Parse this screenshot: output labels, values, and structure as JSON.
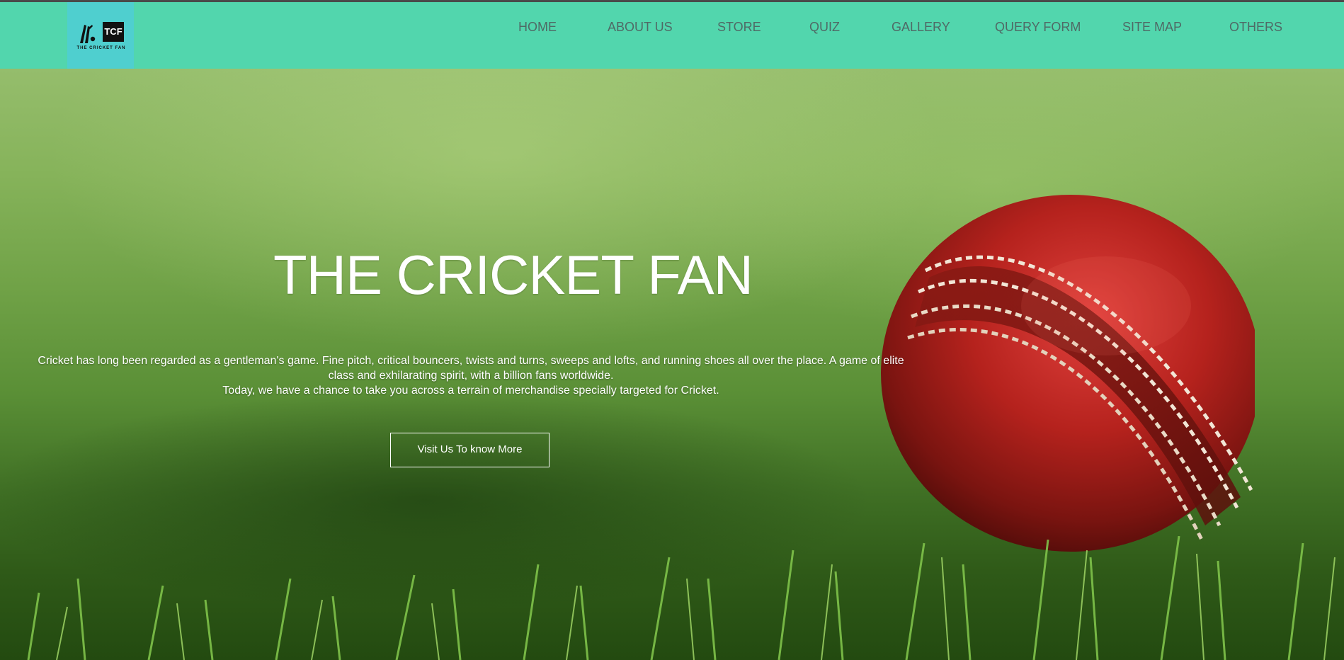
{
  "brand": {
    "logo_badge": "TCF",
    "logo_subtitle": "THE CRICKET FAN"
  },
  "nav": {
    "items": [
      {
        "label": "HOME"
      },
      {
        "label": "ABOUT US"
      },
      {
        "label": "STORE"
      },
      {
        "label": "QUIZ"
      },
      {
        "label": "GALLERY"
      },
      {
        "label": "QUERY FORM"
      },
      {
        "label": "SITE MAP"
      },
      {
        "label": "OTHERS"
      }
    ]
  },
  "hero": {
    "title": "THE CRICKET FAN",
    "paragraph_line1": "Cricket has long been regarded as a gentleman's game. Fine pitch, critical bouncers, twists and turns, sweeps and lofts, and running shoes all over the place. A game of elite class and exhilarating spirit, with a billion fans worldwide.",
    "paragraph_line2": "Today, we have a chance to take you across a terrain of merchandise specially targeted for Cricket.",
    "button_label": "Visit Us To know More",
    "image_subject": "red cricket ball on grass"
  },
  "colors": {
    "navbar": "#52d6ad",
    "logo_bg": "#4fcfcf",
    "nav_text": "#4f6a66",
    "hero_text": "#ffffff"
  }
}
